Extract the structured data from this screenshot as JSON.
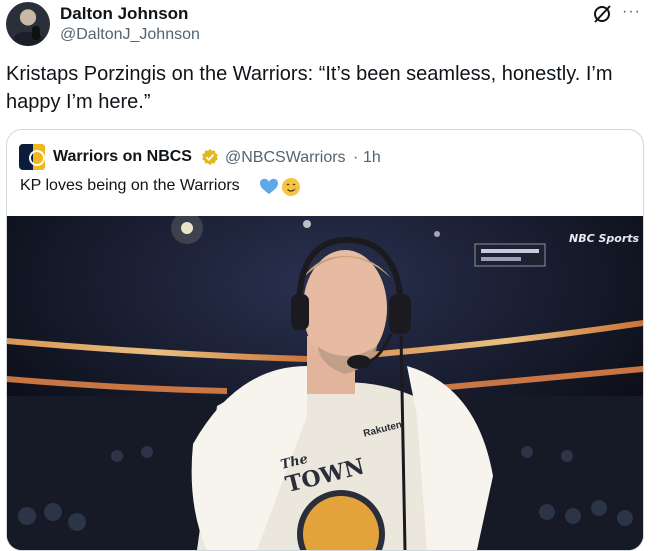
{
  "author": {
    "display_name": "Dalton Johnson",
    "handle": "@DaltonJ_Johnson",
    "avatar_icon": "user-avatar",
    "more_icon": "more-horizontal-icon",
    "more_label": "···"
  },
  "tweet": {
    "text": "Kristaps Porzingis on the Warriors: “It’s been seamless, honestly. I’m happy I’m here.”"
  },
  "quoted": {
    "display_name": "Warriors on NBCS",
    "handle": "@NBCSWarriors",
    "separator": "·",
    "time": "1h",
    "text": "KP loves being on the Warriors",
    "verified_color": "#e2b719",
    "emojis": [
      "blue-heart-icon",
      "smiling-face-with-tear-icon"
    ]
  },
  "media": {
    "network_bug": "NBC Sports",
    "jersey_script": "The",
    "jersey_word": "TOWN",
    "jersey_sponsor": "Rakuten"
  },
  "colors": {
    "text_primary": "#0f1419",
    "text_secondary": "#536471",
    "border": "#cfd9de",
    "blue_heart": "#5da8e6"
  }
}
